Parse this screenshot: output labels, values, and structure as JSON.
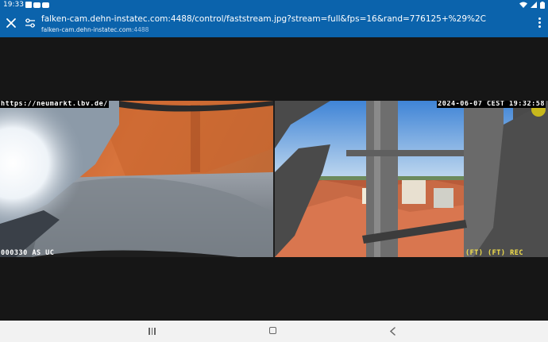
{
  "status_bar": {
    "time": "19:33",
    "notification_icons": [
      "notification-icon",
      "youtube-icon",
      "youtube-icon"
    ],
    "system_icons": [
      "wifi-icon",
      "signal-icon",
      "battery-icon"
    ]
  },
  "toolbar": {
    "url": "falken-cam.dehn-instatec.com:4488/control/faststream.jpg?stream=full&fps=16&rand=776125+%29%2C",
    "host": "falken-cam.dehn-instatec.com",
    "port": ":4488",
    "close_icon": "close-icon",
    "settings_icon": "page-settings-icon",
    "menu_icon": "more-vert-icon"
  },
  "camera": {
    "left": {
      "osd_top": "https://neumarkt.lbv.de/",
      "osd_bottom": "000330 AS UC"
    },
    "right": {
      "osd_top": "2024-06-07 CEST 19:32:58",
      "osd_bottom": "(FT) (FT) REC"
    }
  },
  "navbar": {
    "icons": [
      "recents-icon",
      "home-icon",
      "back-icon"
    ]
  },
  "colors": {
    "toolbar": "#0b63ac",
    "viewer_bg": "#161616",
    "navbar": "#f2f2f2",
    "osd_yellow": "#f4e04a"
  }
}
